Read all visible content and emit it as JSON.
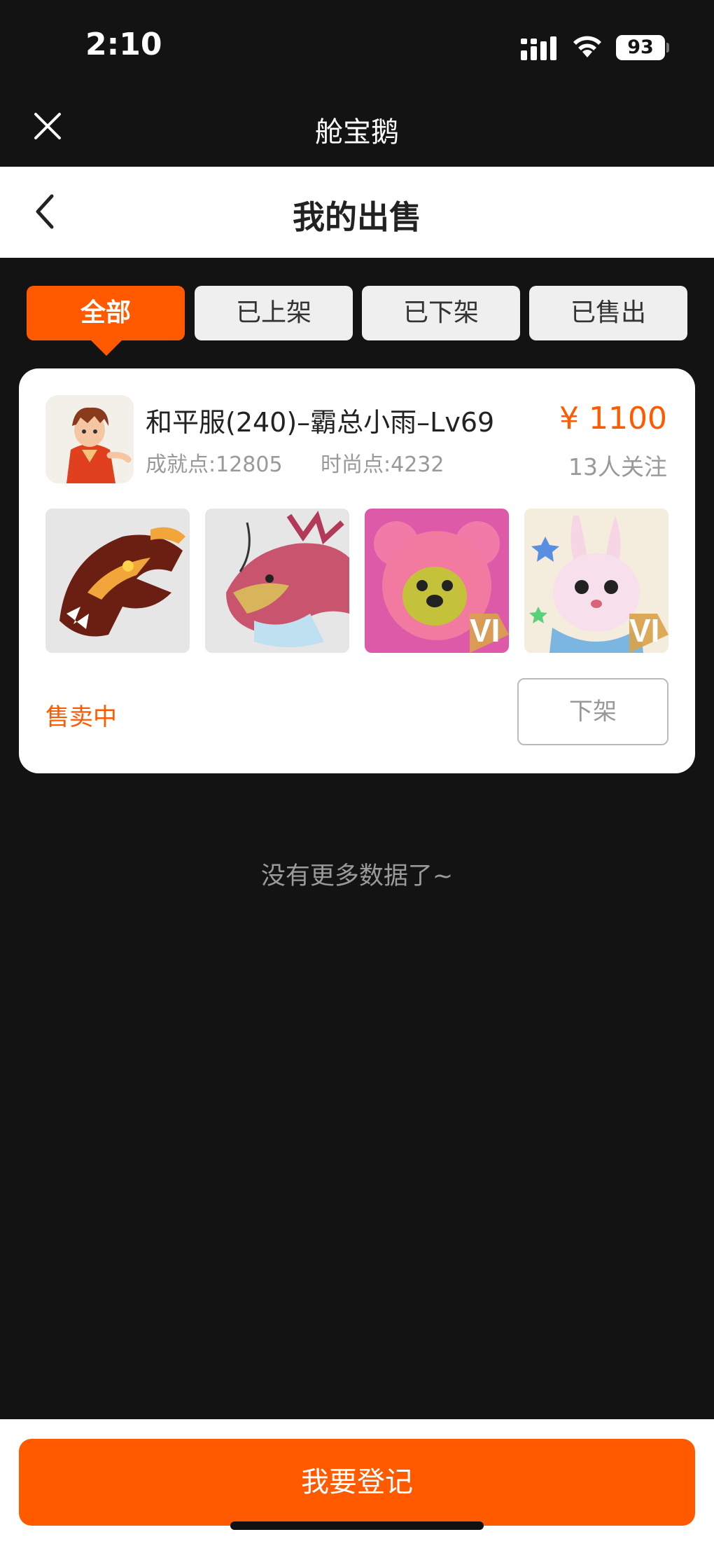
{
  "status_bar": {
    "time": "2:10",
    "battery": "93"
  },
  "app_header": {
    "title": "舱宝鹅"
  },
  "nav": {
    "title": "我的出售"
  },
  "tabs": [
    {
      "label": "全部",
      "active": true
    },
    {
      "label": "已上架",
      "active": false
    },
    {
      "label": "已下架",
      "active": false
    },
    {
      "label": "已售出",
      "active": false
    }
  ],
  "listing": {
    "name": "和平服(240)–霸总小雨–Lv69",
    "achievement_points": "成就点:12805",
    "fashion_points": "时尚点:4232",
    "price": "¥ 1100",
    "followers": "13人关注",
    "thumbnails": [
      "dragon-mount-icon",
      "chinese-dragon-icon",
      "pink-bear-costume-icon",
      "bunny-costume-icon"
    ],
    "status": "售卖中",
    "action_label": "下架"
  },
  "footer_note": "没有更多数据了~",
  "bottom": {
    "button_label": "我要登记"
  },
  "colors": {
    "accent": "#ff5a00",
    "background": "#131313"
  }
}
